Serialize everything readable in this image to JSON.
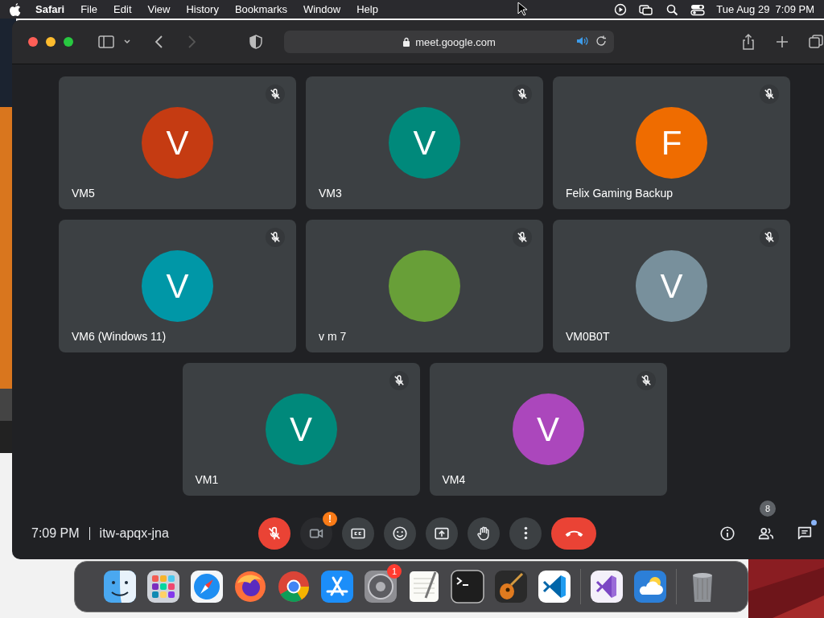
{
  "menu_bar": {
    "app": "Safari",
    "menus": [
      "File",
      "Edit",
      "View",
      "History",
      "Bookmarks",
      "Window",
      "Help"
    ],
    "clock": "Tue Aug 29  7:09 PM"
  },
  "browser": {
    "address": "meet.google.com"
  },
  "participants": [
    {
      "name": "VM5",
      "initial": "V",
      "color": "#c53b12",
      "muted": true
    },
    {
      "name": "VM3",
      "initial": "V",
      "color": "#00897b",
      "muted": true
    },
    {
      "name": "Felix Gaming Backup",
      "initial": "F",
      "color": "#ef6c00",
      "muted": true
    },
    {
      "name": "VM6 (Windows 11)",
      "initial": "V",
      "color": "#0097a7",
      "muted": true
    },
    {
      "name": "v m 7",
      "color": "#689f38",
      "muted": true
    },
    {
      "name": "VM0B0T",
      "initial": "V",
      "color": "#78909c",
      "muted": true
    },
    {
      "name": "VM1",
      "initial": "V",
      "color": "#00897b",
      "muted": true
    },
    {
      "name": "VM4",
      "initial": "V",
      "color": "#ab47bc",
      "muted": true
    }
  ],
  "meeting": {
    "time": "7:09 PM",
    "code": "itw-apqx-jna"
  },
  "controls": [
    {
      "kind": "mic-off"
    },
    {
      "kind": "camera",
      "badge": "!"
    },
    {
      "kind": "captions"
    },
    {
      "kind": "emoji"
    },
    {
      "kind": "present"
    },
    {
      "kind": "hand"
    },
    {
      "kind": "more"
    },
    {
      "kind": "end-call"
    }
  ],
  "side_controls": [
    {
      "kind": "info"
    },
    {
      "kind": "people",
      "badge": "8"
    },
    {
      "kind": "chat",
      "dot": true
    }
  ],
  "dock": [
    {
      "kind": "finder"
    },
    {
      "kind": "launchpad"
    },
    {
      "kind": "safari"
    },
    {
      "kind": "firefox"
    },
    {
      "kind": "chrome"
    },
    {
      "kind": "appstore"
    },
    {
      "kind": "settings",
      "badge": "1"
    },
    {
      "kind": "textedit"
    },
    {
      "kind": "terminal"
    },
    {
      "kind": "guitar"
    },
    {
      "kind": "vscode"
    },
    {
      "kind": "divider"
    },
    {
      "kind": "visualstudio"
    },
    {
      "kind": "weather"
    },
    {
      "kind": "divider"
    },
    {
      "kind": "trash"
    }
  ]
}
